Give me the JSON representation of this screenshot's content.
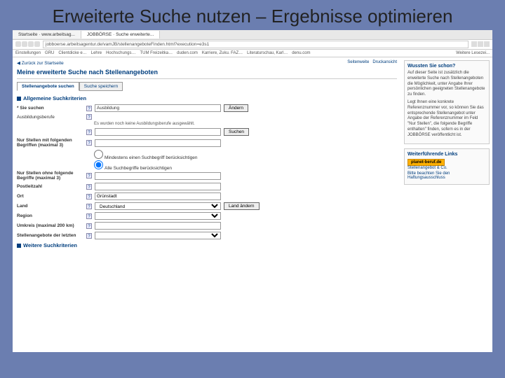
{
  "slide": {
    "title": "Erweiterte Suche nutzen – Ergebnisse optimieren"
  },
  "tabs": {
    "tab1": "Startseite · www.arbeitsag...",
    "tab2": "JOBBÖRSE · Suche erweiterte..."
  },
  "address": {
    "url": "jobboerse.arbeitsagentur.de/vamJB/stellenangeboteFinden.html?execution=e3s1"
  },
  "bookmarks": {
    "b1": "Einstellungen",
    "b2": "GRU",
    "b3": "Clientdicke e…",
    "b4": "Lehre",
    "b5": "Hochschungs…",
    "b6": "TUM Freizeitka…",
    "b7": "duden.com",
    "b8": "Karriere, Zuku. FAZ…",
    "b9": "Literaturschau, Karl…",
    "b10": "denu.com",
    "b11": "Weitere Lesezei..."
  },
  "topnav": {
    "back": "◀ Zurück zur Startseite",
    "right1": "Seitenweite",
    "right2": "Druckansicht"
  },
  "page": {
    "heading": "Meine erweiterte Suche nach Stellenangeboten"
  },
  "formtabs": {
    "t1": "Stellenangebote suchen",
    "t2": "Suche speichern"
  },
  "section1": {
    "title": "Allgemeine Suchkriterien"
  },
  "fields": {
    "sie_suchen": {
      "label": "* Sie suchen",
      "value": "Ausbildung",
      "btn": "Ändern"
    },
    "ausbildungsberufe": {
      "label": "Ausbildungsberufe",
      "info": "Es wurden noch keine Ausbildungsberufe ausgewählt.",
      "btn": "Suchen"
    },
    "empty_field": {
      "label": ""
    },
    "nur_mit": {
      "label": "Nur Stellen mit folgenden Begriffen (maximal 3)"
    },
    "radio1": "Mindestens einen Suchbegriff berücksichtigen",
    "radio2": "Alle Suchbegriffe berücksichtigen",
    "nur_ohne": {
      "label": "Nur Stellen ohne folgende Begriffe (maximal 3)"
    },
    "plz": {
      "label": "Postleitzahl"
    },
    "ort": {
      "label": "Ort",
      "value": "Grünstadt"
    },
    "land": {
      "label": "Land",
      "value": "Deutschland",
      "btn": "Land ändern"
    },
    "region": {
      "label": "Region"
    },
    "umkreis": {
      "label": "Umkreis (maximal 200 km)"
    },
    "letzte": {
      "label": "Stellenangebote der letzten"
    }
  },
  "section2": {
    "title": "Weitere Suchkriterien"
  },
  "sidebar": {
    "box1": {
      "title": "Wussten Sie schon?",
      "p1": "Auf dieser Seite ist zusätzlich die erweiterte Suche nach Stellenangeboten die Möglichkeit, unter Angabe Ihrer persönlichen geeigneten Stellenangebote zu finden.",
      "p2": "Legt Ihnen eine konkrete Referenznummer vor, so können Sie das entsprechende Stellenangebot unter Angabe der Referenznummer im Feld \"Nur Stellen\", die folgende Begriffe enthalten\" finden, sofern es in der JOBBÖRSE veröffentlicht ist."
    },
    "box2": {
      "title": "Weiterführende Links",
      "logo": "planet-beruf.de",
      "link1": "Stellenangebot & Co.",
      "link2": "Bitte beachten Sie den Haftungsausschluss"
    }
  }
}
